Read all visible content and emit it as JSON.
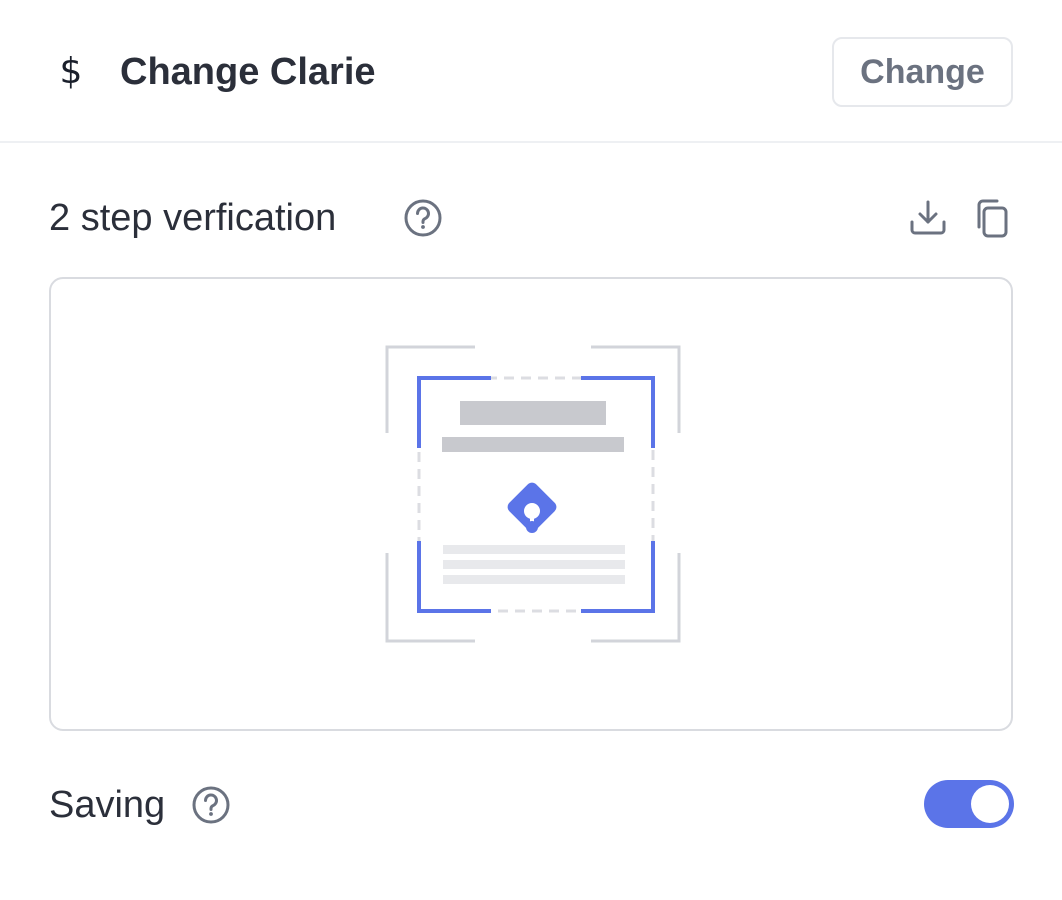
{
  "header": {
    "icon": "dollar-icon",
    "icon_glyph": "$",
    "title": "Change Clarie",
    "change_button_label": "Change"
  },
  "section": {
    "title": "2 step verfication",
    "help_icon": "question-circle-icon",
    "actions": [
      "download-icon",
      "copy-icon"
    ]
  },
  "qr_placeholder": {
    "icon": "qr-document-illustration"
  },
  "saving": {
    "label": "Saving",
    "help_icon": "question-circle-icon",
    "toggle_on": true
  },
  "colors": {
    "accent": "#5b74e8",
    "text": "#2b2f3a",
    "muted": "#6b7280",
    "border": "#d9dbe0",
    "placeholder_gray": "#c8c9ce",
    "placeholder_light": "#e8e9ec"
  }
}
